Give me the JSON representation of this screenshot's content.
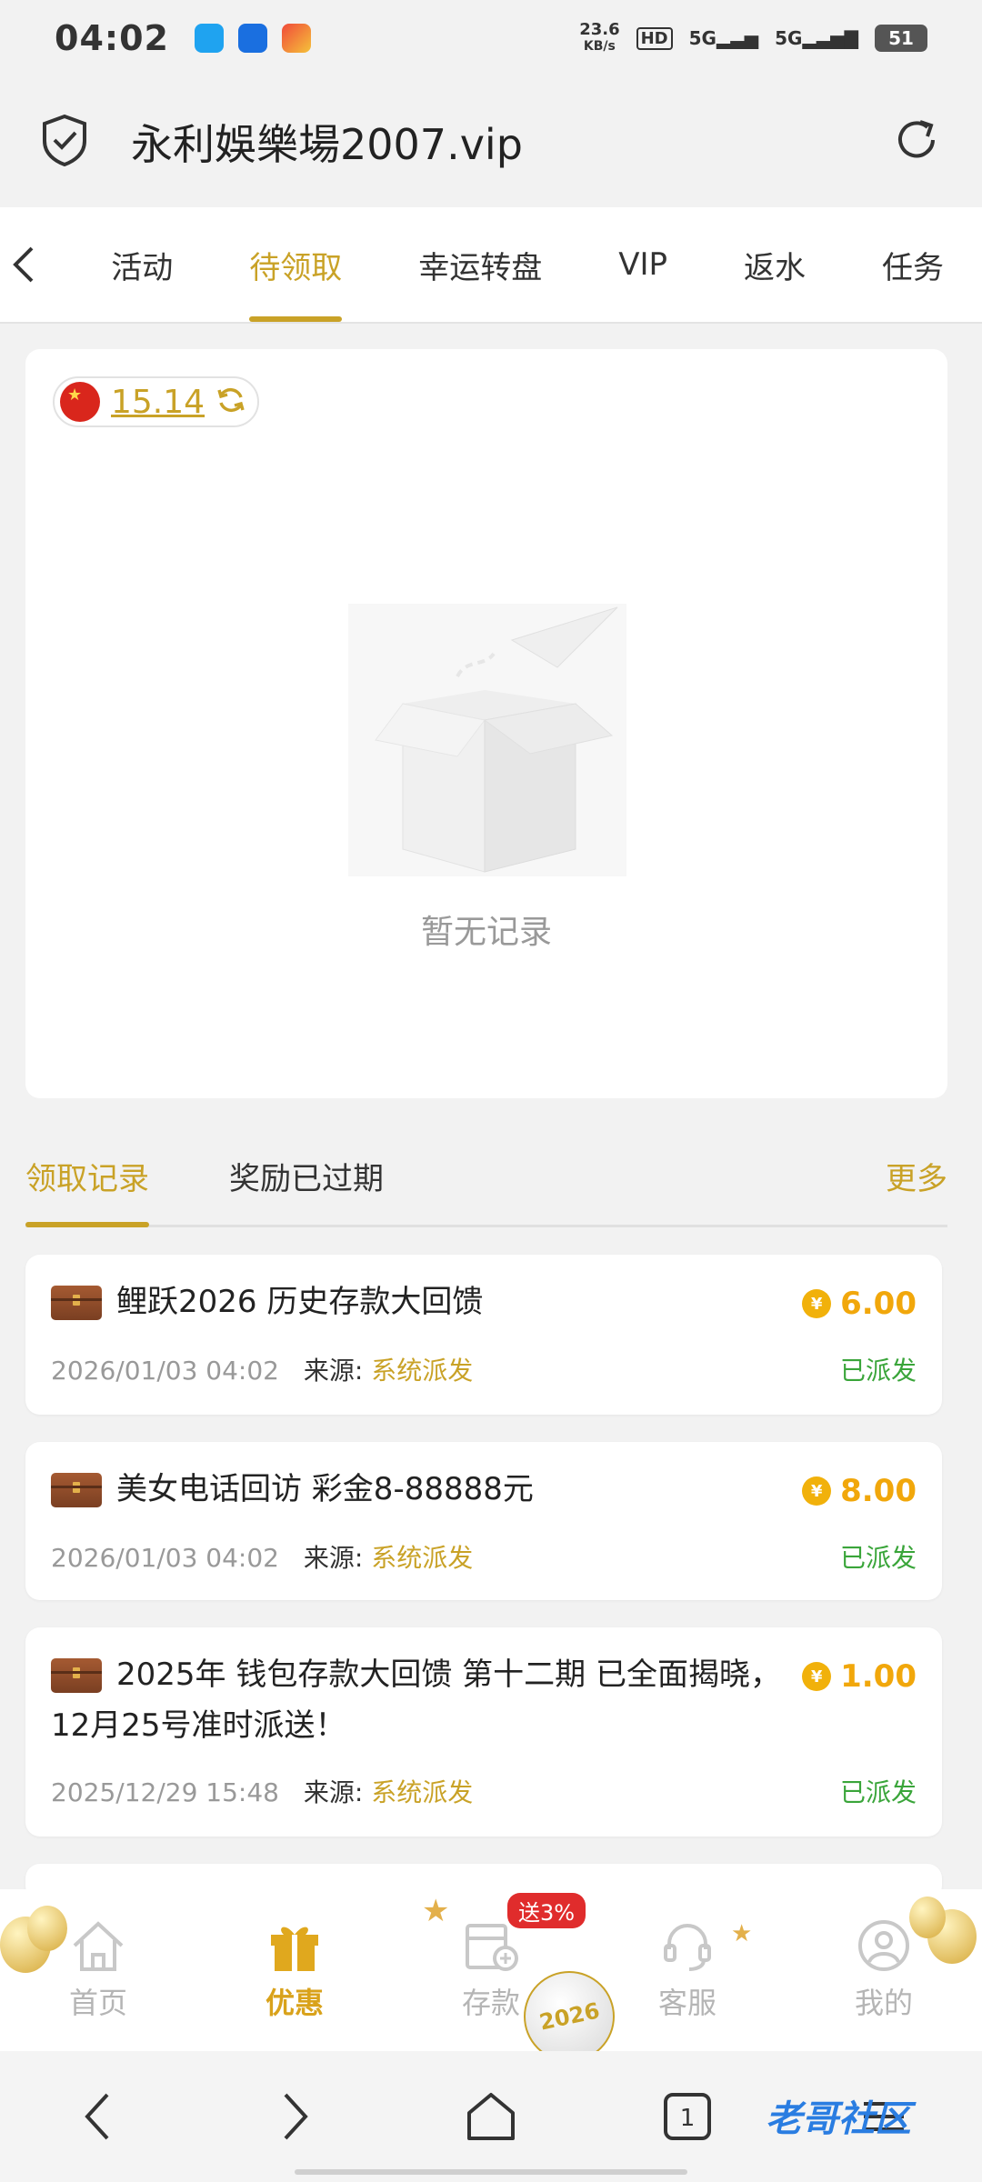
{
  "status_bar": {
    "time": "04:02",
    "net_speed_value": "23.6",
    "net_speed_unit": "KB/s",
    "hd_label": "HD",
    "sig1": "5G",
    "sig2": "5G",
    "battery": "51"
  },
  "browser": {
    "url": "永利娛樂場2007.vip"
  },
  "tabs": [
    {
      "label": "活动"
    },
    {
      "label": "待领取"
    },
    {
      "label": "幸运转盘"
    },
    {
      "label": "VIP"
    },
    {
      "label": "返水"
    },
    {
      "label": "任务"
    }
  ],
  "balance": {
    "value": "15.14"
  },
  "empty": {
    "text": "暂无记录"
  },
  "record_tabs": {
    "claimed": "领取记录",
    "expired": "奖励已过期",
    "more": "更多"
  },
  "records": [
    {
      "title": "鲤跃2026 历史存款大回馈",
      "amount": "6.00",
      "time": "2026/01/03 04:02",
      "source_label": "来源:",
      "source": "系统派发",
      "status": "已派发"
    },
    {
      "title": "美女电话回访 彩金8-88888元",
      "amount": "8.00",
      "time": "2026/01/03 04:02",
      "source_label": "来源:",
      "source": "系统派发",
      "status": "已派发"
    },
    {
      "title": "2025年 钱包存款大回馈 第十二期 已全面揭晓，12月25号准时派送！",
      "amount": "1.00",
      "time": "2025/12/29 15:48",
      "source_label": "来源:",
      "source": "系统派发",
      "status": "已派发"
    }
  ],
  "coin_symbol": "¥",
  "bottom_nav": [
    {
      "label": "首页",
      "icon": "home-icon"
    },
    {
      "label": "优惠",
      "icon": "gift-icon"
    },
    {
      "label": "存款",
      "icon": "deposit-icon"
    },
    {
      "label": "客服",
      "icon": "headset-icon"
    },
    {
      "label": "我的",
      "icon": "user-icon"
    }
  ],
  "promo_badge": "送3%",
  "year_ornament": "2026",
  "tab_badge_count": "1",
  "watermark": "老哥社区",
  "colors": {
    "accent": "#c9a227",
    "amount": "#f1a70b",
    "success": "#3aa53a",
    "badge": "#e02c2c"
  }
}
